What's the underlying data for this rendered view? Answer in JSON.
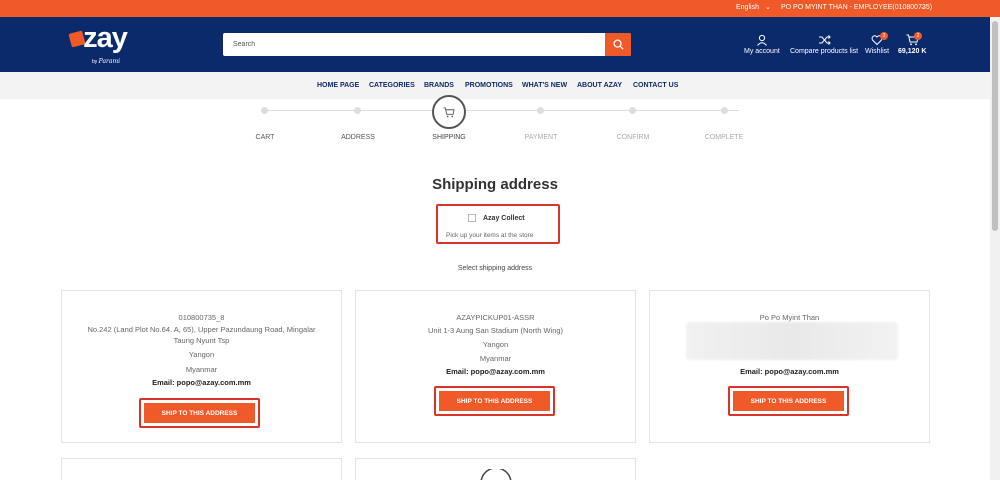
{
  "topbar": {
    "language": "English",
    "user": "PO PO MYINT THAN - EMPLOYEE(010800735)"
  },
  "logo": {
    "word": "azay",
    "by": "by",
    "brand": "Parami"
  },
  "search": {
    "placeholder": "Search"
  },
  "header_icons": {
    "account": "My account",
    "compare": "Compare products list",
    "wishlist": "Wishlist",
    "wishlist_count": "3",
    "cart_total": "69,120 K",
    "cart_count": "2"
  },
  "nav": [
    "HOME PAGE",
    "CATEGORIES",
    "BRANDS",
    "PROMOTIONS",
    "WHAT'S NEW",
    "ABOUT AZAY",
    "CONTACT US"
  ],
  "steps": [
    "CART",
    "ADDRESS",
    "SHIPPING",
    "PAYMENT",
    "CONFIRM",
    "COMPLETE"
  ],
  "page_title": "Shipping address",
  "collect": {
    "label": "Azay Collect",
    "sub": "Pick up your items at the store"
  },
  "select_label": "Select shipping address",
  "cards": [
    {
      "lines": [
        "010800735_8",
        "No.242 (Land Plot No.64. A, 65), Upper Pazundaung Road, Mingalar",
        "Taung Nyunt Tsp",
        "Yangon",
        "Myanmar"
      ],
      "email": "Email: popo@azay.com.mm",
      "button": "SHIP TO THIS ADDRESS"
    },
    {
      "lines": [
        "AZAYPICKUP01-ASSR",
        "Unit 1-3 Aung San Stadium (North Wing)",
        "Yangon",
        "Myanmar"
      ],
      "email": "Email: popo@azay.com.mm",
      "button": "SHIP TO THIS ADDRESS"
    },
    {
      "lines": [
        "Po Po Myint Than"
      ],
      "email": "Email: popo@azay.com.mm",
      "button": "SHIP TO THIS ADDRESS"
    }
  ],
  "colors": {
    "orange": "#f05a28",
    "navy": "#0b2a6b",
    "highlight": "#d9332a"
  }
}
